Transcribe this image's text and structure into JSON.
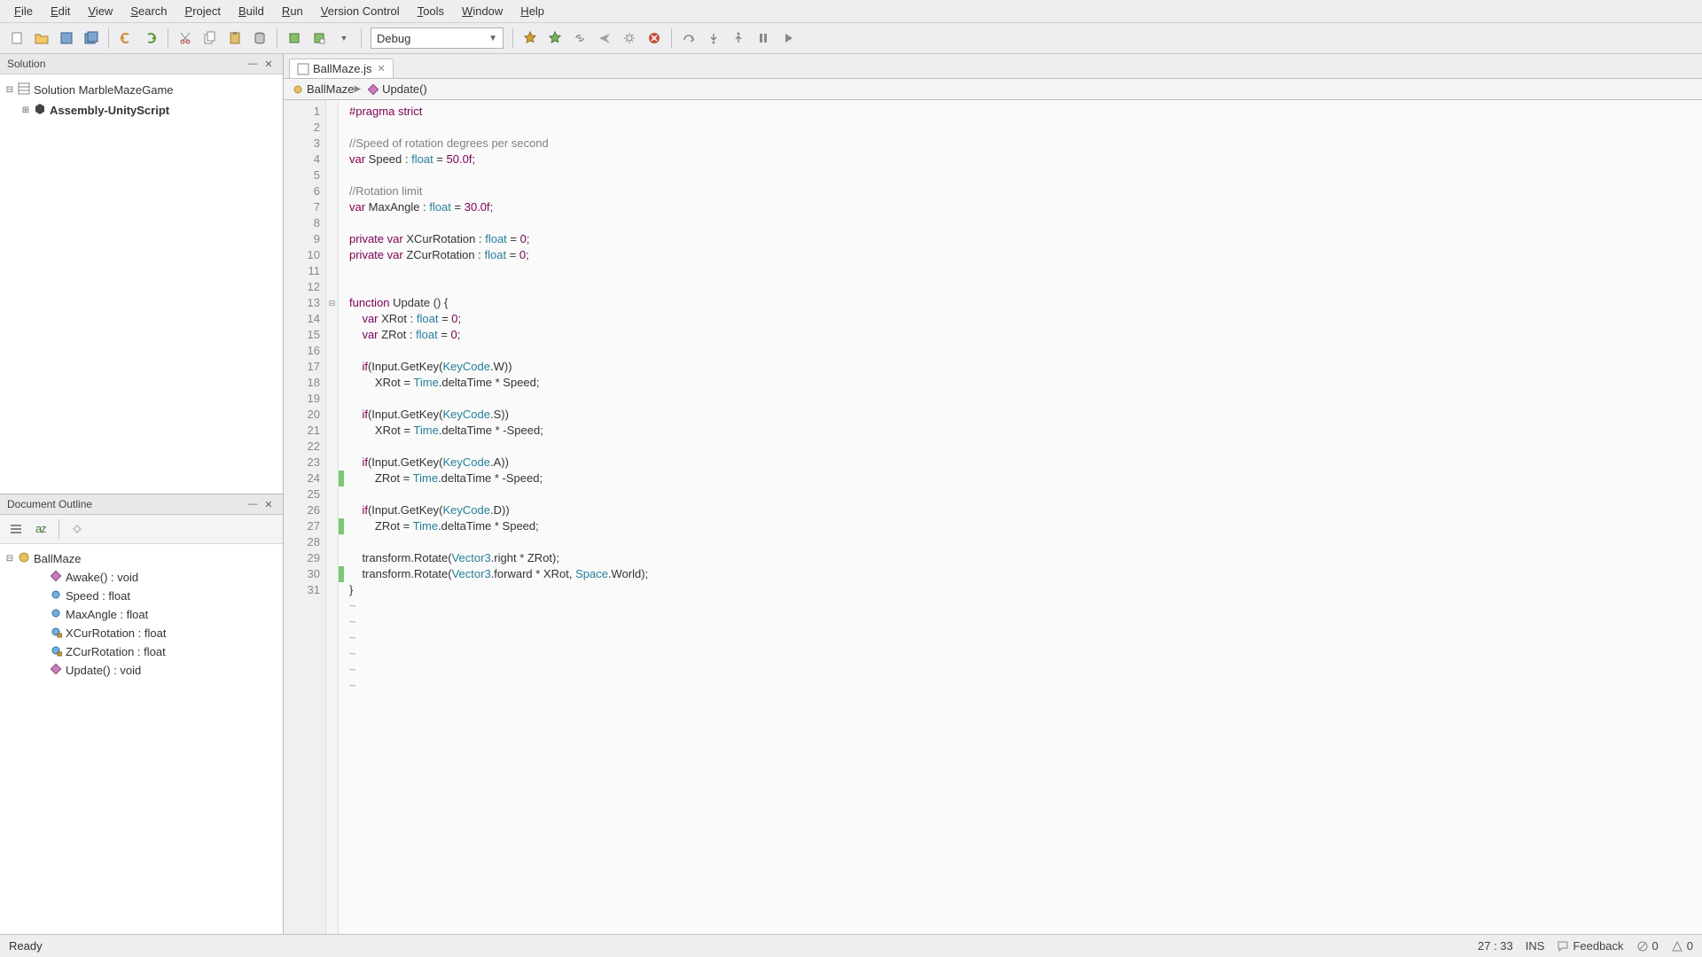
{
  "menubar": [
    "File",
    "Edit",
    "View",
    "Search",
    "Project",
    "Build",
    "Run",
    "Version Control",
    "Tools",
    "Window",
    "Help"
  ],
  "toolbar": {
    "combo": {
      "value": "Debug"
    },
    "icons": [
      "new-file",
      "open-file",
      "save",
      "save-all",
      "undo",
      "redo",
      "cut",
      "copy",
      "paste",
      "database",
      "build",
      "build-clean",
      "build-dropdown",
      "debug-attach",
      "debug-play",
      "link",
      "airplane",
      "gear",
      "stop",
      "step-over",
      "step-in",
      "step-out",
      "pause",
      "resume"
    ]
  },
  "panels": {
    "solution": {
      "title": "Solution",
      "root": {
        "label": "Solution MarbleMazeGame"
      },
      "children": [
        {
          "label": "Assembly-UnityScript",
          "bold": true
        }
      ]
    },
    "outline": {
      "title": "Document Outline",
      "root": {
        "label": "BallMaze"
      },
      "members": [
        {
          "label": "Awake() : void",
          "kind": "method-private"
        },
        {
          "label": "Speed : float",
          "kind": "field-public"
        },
        {
          "label": "MaxAngle : float",
          "kind": "field-public"
        },
        {
          "label": "XCurRotation : float",
          "kind": "field-private"
        },
        {
          "label": "ZCurRotation : float",
          "kind": "field-private"
        },
        {
          "label": "Update() : void",
          "kind": "method-private"
        }
      ]
    }
  },
  "editor": {
    "tab": {
      "label": "BallMaze.js"
    },
    "breadcrumb": [
      {
        "label": "BallMaze",
        "icon": "class"
      },
      {
        "label": "Update()",
        "icon": "method"
      }
    ],
    "code": [
      {
        "n": 1,
        "ch": false,
        "tokens": [
          [
            "#pragma",
            "key"
          ],
          [
            " ",
            ""
          ],
          [
            "strict",
            "key"
          ]
        ]
      },
      {
        "n": 2,
        "ch": false,
        "tokens": []
      },
      {
        "n": 3,
        "ch": false,
        "tokens": [
          [
            "//Speed of rotation degrees per second",
            "com"
          ]
        ]
      },
      {
        "n": 4,
        "ch": false,
        "tokens": [
          [
            "var",
            "key"
          ],
          [
            " Speed : ",
            ""
          ],
          [
            "float",
            "type"
          ],
          [
            " = ",
            ""
          ],
          [
            "50.0f",
            "num"
          ],
          [
            ";",
            ""
          ]
        ]
      },
      {
        "n": 5,
        "ch": false,
        "tokens": []
      },
      {
        "n": 6,
        "ch": false,
        "tokens": [
          [
            "//Rotation limit",
            "com"
          ]
        ]
      },
      {
        "n": 7,
        "ch": false,
        "tokens": [
          [
            "var",
            "key"
          ],
          [
            " MaxAngle : ",
            ""
          ],
          [
            "float",
            "type"
          ],
          [
            " = ",
            ""
          ],
          [
            "30.0f",
            "num"
          ],
          [
            ";",
            ""
          ]
        ]
      },
      {
        "n": 8,
        "ch": false,
        "tokens": []
      },
      {
        "n": 9,
        "ch": false,
        "tokens": [
          [
            "private",
            "key"
          ],
          [
            " ",
            ""
          ],
          [
            "var",
            "key"
          ],
          [
            " XCurRotation : ",
            ""
          ],
          [
            "float",
            "type"
          ],
          [
            " = ",
            ""
          ],
          [
            "0",
            "num"
          ],
          [
            ";",
            ""
          ]
        ]
      },
      {
        "n": 10,
        "ch": false,
        "tokens": [
          [
            "private",
            "key"
          ],
          [
            " ",
            ""
          ],
          [
            "var",
            "key"
          ],
          [
            " ZCurRotation : ",
            ""
          ],
          [
            "float",
            "type"
          ],
          [
            " = ",
            ""
          ],
          [
            "0",
            "num"
          ],
          [
            ";",
            ""
          ]
        ]
      },
      {
        "n": 11,
        "ch": false,
        "tokens": []
      },
      {
        "n": 12,
        "ch": false,
        "tokens": []
      },
      {
        "n": 13,
        "ch": false,
        "fold": true,
        "tokens": [
          [
            "function",
            "key"
          ],
          [
            " Update () {",
            ""
          ]
        ]
      },
      {
        "n": 14,
        "ch": false,
        "tokens": [
          [
            "    ",
            ""
          ],
          [
            "var",
            "key"
          ],
          [
            " XRot : ",
            ""
          ],
          [
            "float",
            "type"
          ],
          [
            " = ",
            ""
          ],
          [
            "0",
            "num"
          ],
          [
            ";",
            ""
          ]
        ]
      },
      {
        "n": 15,
        "ch": false,
        "tokens": [
          [
            "    ",
            ""
          ],
          [
            "var",
            "key"
          ],
          [
            " ZRot : ",
            ""
          ],
          [
            "float",
            "type"
          ],
          [
            " = ",
            ""
          ],
          [
            "0",
            "num"
          ],
          [
            ";",
            ""
          ]
        ]
      },
      {
        "n": 16,
        "ch": false,
        "tokens": []
      },
      {
        "n": 17,
        "ch": false,
        "tokens": [
          [
            "    ",
            ""
          ],
          [
            "if",
            "key"
          ],
          [
            "(Input.GetKey(",
            ""
          ],
          [
            "KeyCode",
            "id"
          ],
          [
            ".W))",
            ""
          ]
        ]
      },
      {
        "n": 18,
        "ch": false,
        "tokens": [
          [
            "        XRot = ",
            ""
          ],
          [
            "Time",
            "id"
          ],
          [
            ".deltaTime * Speed;",
            ""
          ]
        ]
      },
      {
        "n": 19,
        "ch": false,
        "tokens": []
      },
      {
        "n": 20,
        "ch": false,
        "tokens": [
          [
            "    ",
            ""
          ],
          [
            "if",
            "key"
          ],
          [
            "(Input.GetKey(",
            ""
          ],
          [
            "KeyCode",
            "id"
          ],
          [
            ".S))",
            ""
          ]
        ]
      },
      {
        "n": 21,
        "ch": false,
        "tokens": [
          [
            "        XRot = ",
            ""
          ],
          [
            "Time",
            "id"
          ],
          [
            ".deltaTime * -Speed;",
            ""
          ]
        ]
      },
      {
        "n": 22,
        "ch": false,
        "tokens": []
      },
      {
        "n": 23,
        "ch": false,
        "tokens": [
          [
            "    ",
            ""
          ],
          [
            "if",
            "key"
          ],
          [
            "(Input.GetKey(",
            ""
          ],
          [
            "KeyCode",
            "id"
          ],
          [
            ".A))",
            ""
          ]
        ]
      },
      {
        "n": 24,
        "ch": true,
        "tokens": [
          [
            "        ZRot = ",
            ""
          ],
          [
            "Time",
            "id"
          ],
          [
            ".deltaTime * -Speed;",
            ""
          ]
        ]
      },
      {
        "n": 25,
        "ch": false,
        "tokens": []
      },
      {
        "n": 26,
        "ch": false,
        "tokens": [
          [
            "    ",
            ""
          ],
          [
            "if",
            "key"
          ],
          [
            "(Input.GetKey(",
            ""
          ],
          [
            "KeyCode",
            "id"
          ],
          [
            ".D))",
            ""
          ]
        ]
      },
      {
        "n": 27,
        "ch": true,
        "tokens": [
          [
            "        ZRot = ",
            ""
          ],
          [
            "Time",
            "id"
          ],
          [
            ".deltaTime * Speed;",
            ""
          ]
        ]
      },
      {
        "n": 28,
        "ch": false,
        "tokens": []
      },
      {
        "n": 29,
        "ch": false,
        "tokens": [
          [
            "    transform.Rotate(",
            ""
          ],
          [
            "Vector3",
            "id"
          ],
          [
            ".right * ZRot);",
            ""
          ]
        ]
      },
      {
        "n": 30,
        "ch": true,
        "tokens": [
          [
            "    transform.Rotate(",
            ""
          ],
          [
            "Vector3",
            "id"
          ],
          [
            ".forward * XRot, ",
            ""
          ],
          [
            "Space",
            "id"
          ],
          [
            ".World);",
            ""
          ]
        ]
      },
      {
        "n": 31,
        "ch": false,
        "tokens": [
          [
            "}",
            ""
          ]
        ]
      }
    ],
    "tilde_rows": 6
  },
  "statusbar": {
    "left": "Ready",
    "position": "27 : 33",
    "mode": "INS",
    "feedback": "Feedback",
    "errors": "0",
    "warnings": "0"
  }
}
